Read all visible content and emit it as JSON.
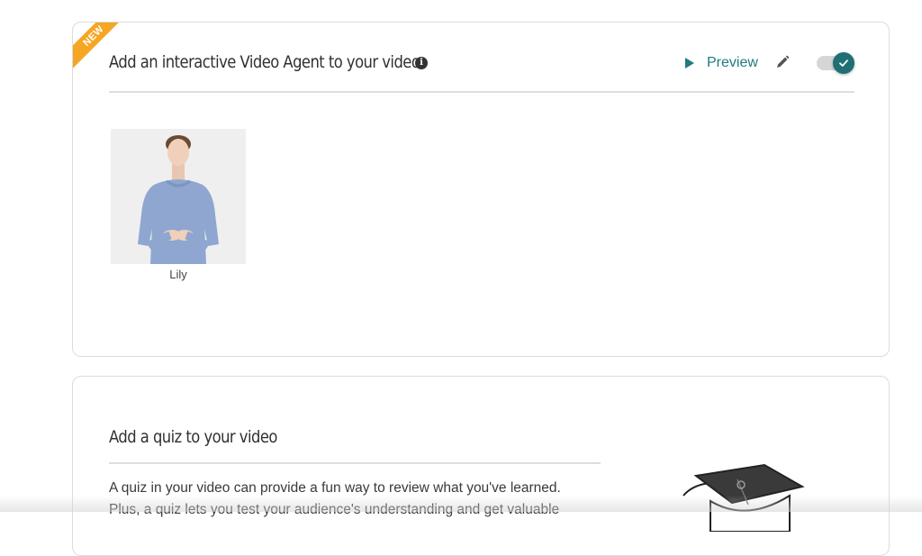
{
  "agent_card": {
    "badge": "NEW",
    "title": "Add an interactive Video Agent to your video.",
    "info_icon": "i",
    "preview_label": "Preview",
    "icons": {
      "preview": "play-icon",
      "edit": "pencil-icon",
      "toggle": "check-icon"
    },
    "toggle_on": true,
    "agents": [
      {
        "name": "Lily"
      }
    ]
  },
  "quiz_card": {
    "title": "Add a quiz to your video",
    "description": "A quiz in your video can provide a fun way to review what you've learned. Plus, a quiz lets you test your audience's understanding and get valuable"
  },
  "colors": {
    "accent": "#1f7b7f",
    "badge": "#f5a623",
    "border": "#dcdcdc"
  }
}
